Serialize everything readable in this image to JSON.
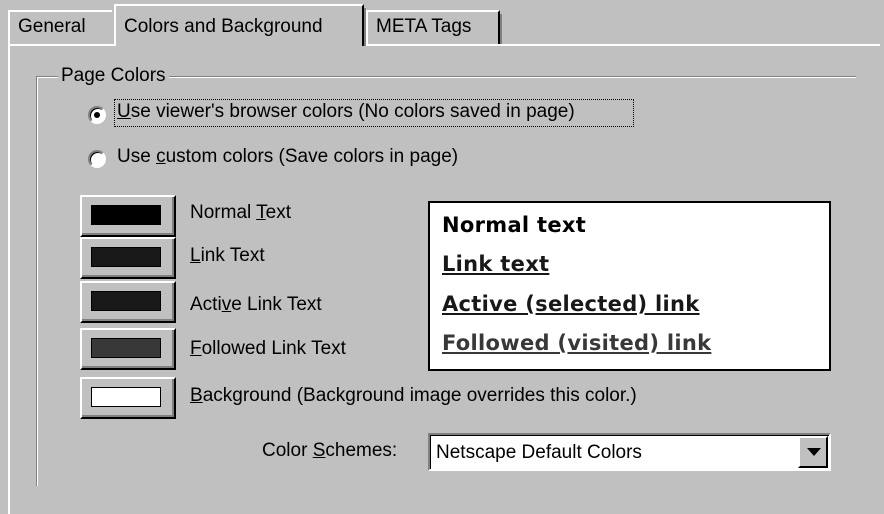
{
  "tabs": [
    {
      "label": "General"
    },
    {
      "label": "Colors and Background"
    },
    {
      "label": "META Tags"
    }
  ],
  "page_colors": {
    "legend": "Page Colors",
    "option_viewer": {
      "pre": "",
      "key": "U",
      "post": "se viewer's browser colors (No colors saved in page)",
      "selected": true
    },
    "option_custom": {
      "pre": "Use ",
      "key": "c",
      "post": "ustom colors (Save colors in page)",
      "selected": false
    }
  },
  "color_rows": [
    {
      "pre": "Normal ",
      "key": "T",
      "post": "ext",
      "swatch": "#000000"
    },
    {
      "pre": "",
      "key": "L",
      "post": "ink Text",
      "swatch": "#181818"
    },
    {
      "pre": "Acti",
      "key": "v",
      "post": "e Link Text",
      "swatch": "#181818"
    },
    {
      "pre": "",
      "key": "F",
      "post": "ollowed Link Text",
      "swatch": "#383838"
    },
    {
      "pre": "",
      "key": "B",
      "post": "ackground (Background image overrides this color.)",
      "swatch": "#ffffff"
    }
  ],
  "preview": {
    "normal": "Normal text",
    "link": "Link text",
    "active": "Active (selected) link",
    "followed": "Followed (visited) link",
    "colors": {
      "normal": "#000000",
      "link": "#181818",
      "active": "#181818",
      "followed": "#383838"
    }
  },
  "color_schemes": {
    "label_pre": "Color ",
    "label_key": "S",
    "label_post": "chemes:",
    "value": "Netscape Default Colors"
  }
}
